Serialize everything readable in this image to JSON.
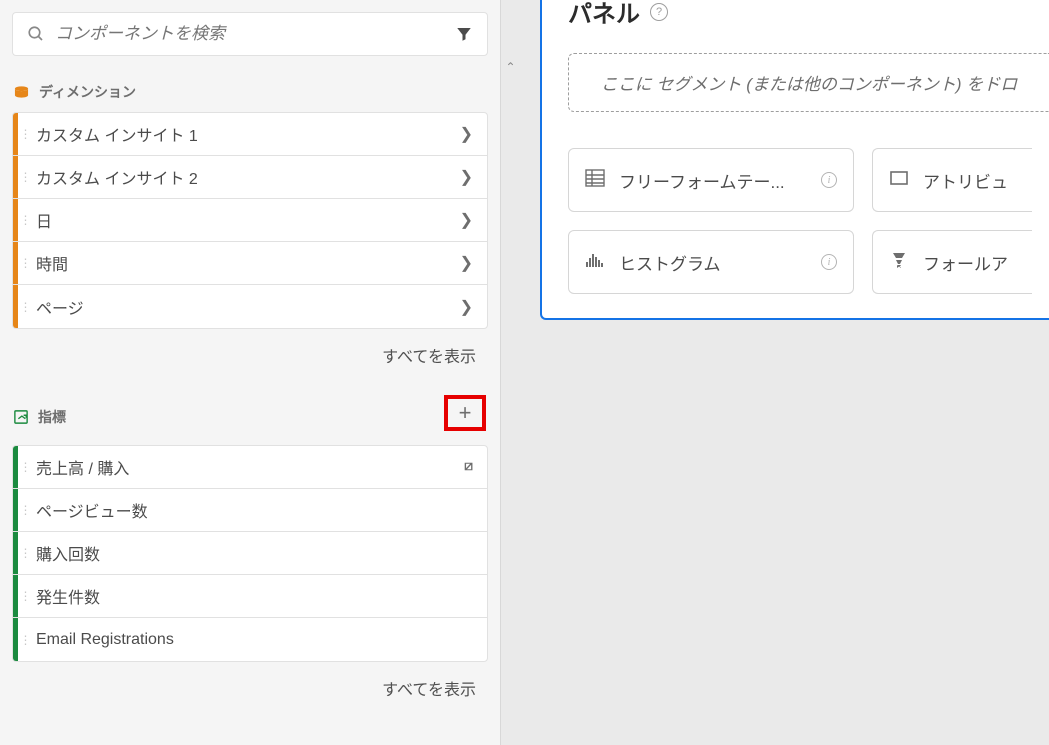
{
  "search": {
    "placeholder": "コンポーネントを検索"
  },
  "sections": {
    "dimensions": {
      "title": "ディメンション",
      "items": [
        {
          "label": "カスタム インサイト 1"
        },
        {
          "label": "カスタム インサイト 2"
        },
        {
          "label": "日"
        },
        {
          "label": "時間"
        },
        {
          "label": "ページ"
        }
      ],
      "show_all": "すべてを表示"
    },
    "metrics": {
      "title": "指標",
      "items": [
        {
          "label": "売上高 / 購入",
          "adobe": true
        },
        {
          "label": "ページビュー数"
        },
        {
          "label": "購入回数"
        },
        {
          "label": "発生件数"
        },
        {
          "label": "Email Registrations"
        }
      ],
      "show_all": "すべてを表示"
    }
  },
  "panel": {
    "title": "パネル",
    "dropzone": "ここに セグメント (または他のコンポーネント) をドロ",
    "cards": {
      "freeform": "フリーフォームテー...",
      "histogram": "ヒストグラム",
      "attribution": "アトリビュ",
      "fallout": "フォールア"
    }
  }
}
